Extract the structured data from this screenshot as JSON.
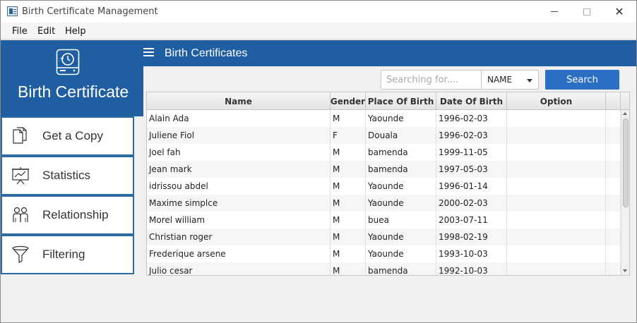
{
  "window": {
    "title": "Birth Certificate Management",
    "minimize_glyph": "—",
    "maximize_glyph": "☐",
    "close_glyph": "✕"
  },
  "menu": {
    "items": [
      "File",
      "Edit",
      "Help"
    ]
  },
  "sidebar": {
    "brand": "Birth Certificate",
    "logo_icon": "drive-clock-icon",
    "items": [
      {
        "label": "Get a Copy",
        "icon": "documents-icon"
      },
      {
        "label": "Statistics",
        "icon": "chart-board-icon"
      },
      {
        "label": "Relationship",
        "icon": "people-icon"
      },
      {
        "label": "Filtering",
        "icon": "funnel-icon"
      }
    ]
  },
  "header": {
    "title": "Birth Certificates",
    "menu_icon": "hamburger-icon"
  },
  "search": {
    "placeholder": "Searching for....",
    "value": "",
    "field_selected": "NAME",
    "button_label": "Search"
  },
  "table": {
    "columns": [
      "Name",
      "Gender",
      "Place Of Birth",
      "Date Of Birth",
      "Option"
    ],
    "rows": [
      {
        "name": "Alain Ada",
        "gender": "M",
        "place": "Yaounde",
        "date": "1996-02-03",
        "option": ""
      },
      {
        "name": "Juliene Fiol",
        "gender": "F",
        "place": "Douala",
        "date": "1996-02-03",
        "option": ""
      },
      {
        "name": "Joel fah",
        "gender": "M",
        "place": "bamenda",
        "date": "1999-11-05",
        "option": ""
      },
      {
        "name": "Jean mark",
        "gender": "M",
        "place": "bamenda",
        "date": "1997-05-03",
        "option": ""
      },
      {
        "name": "idrissou abdel",
        "gender": "M",
        "place": "Yaounde",
        "date": "1996-01-14",
        "option": ""
      },
      {
        "name": "Maxime simplce",
        "gender": "M",
        "place": "Yaounde",
        "date": "2000-02-03",
        "option": ""
      },
      {
        "name": "Morel william",
        "gender": "M",
        "place": "buea",
        "date": "2003-07-11",
        "option": ""
      },
      {
        "name": "Christian roger",
        "gender": "M",
        "place": "Yaounde",
        "date": "1998-02-19",
        "option": ""
      },
      {
        "name": "Frederique arsene",
        "gender": "M",
        "place": "Yaounde",
        "date": "1993-10-03",
        "option": ""
      },
      {
        "name": "Julio cesar",
        "gender": "M",
        "place": "bamenda",
        "date": "1992-10-03",
        "option": ""
      }
    ]
  },
  "colors": {
    "primary": "#1f5fa1",
    "button": "#2a6fc4",
    "nav_border": "#2e6aa6"
  }
}
